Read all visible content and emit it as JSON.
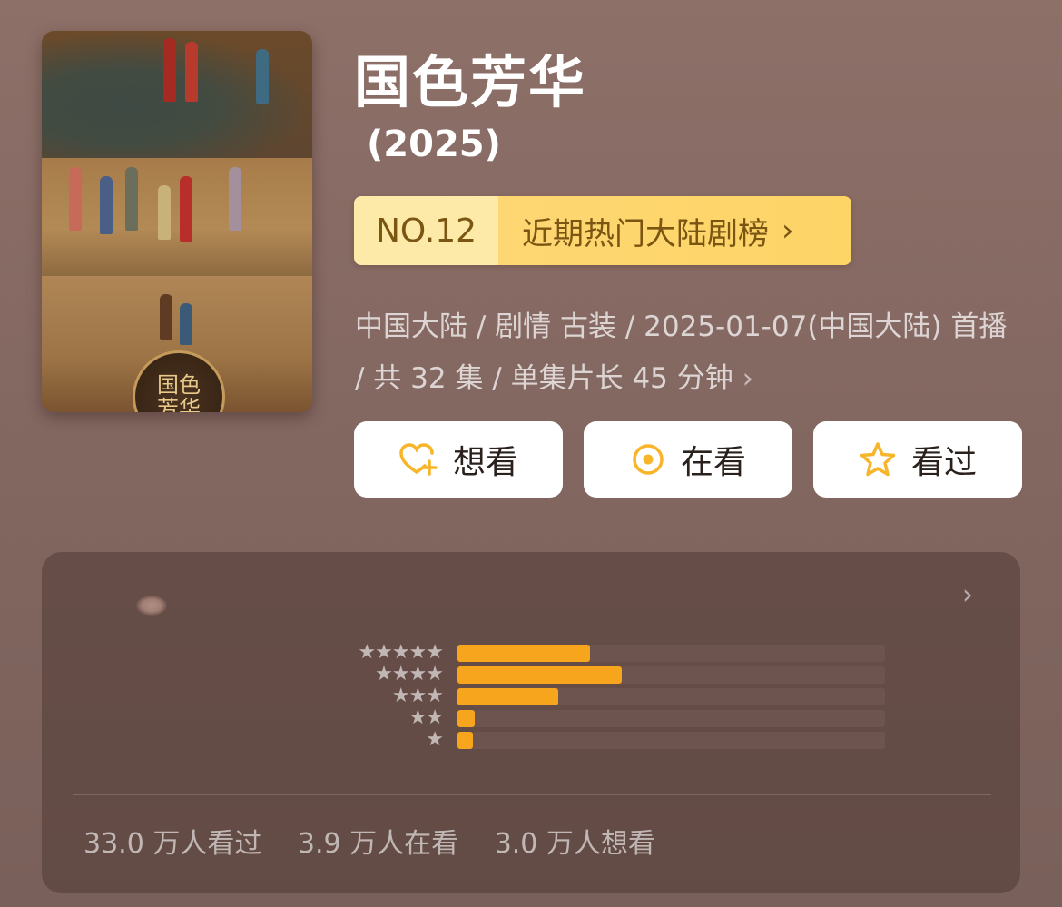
{
  "poster": {
    "seal_text": "国色芳华"
  },
  "title": "国色芳华",
  "year": "(2025)",
  "rank": {
    "number": "NO.12",
    "list_name": "近期热门大陆剧榜",
    "arrow": "›"
  },
  "meta": {
    "text": "中国大陆 / 剧情 古装 / 2025-01-07(中国大陆) 首播 / 共 32 集 / 单集片长 45 分钟",
    "chevron": "›"
  },
  "actions": {
    "want_label": "想看",
    "watching_label": "在看",
    "watched_label": "看过",
    "icon_color": "#f7b52a"
  },
  "rating": {
    "chevron": "›",
    "distribution": [
      {
        "stars": "★★★★★",
        "fraction": 0.31
      },
      {
        "stars": "★★★★",
        "fraction": 0.385
      },
      {
        "stars": "★★★",
        "fraction": 0.235
      },
      {
        "stars": "★★",
        "fraction": 0.04
      },
      {
        "stars": "★",
        "fraction": 0.036
      }
    ],
    "bar_color": "#f7a51d"
  },
  "stats": {
    "watched": "33.0 万人看过",
    "watching": "3.9 万人在看",
    "want": "3.0 万人想看"
  }
}
